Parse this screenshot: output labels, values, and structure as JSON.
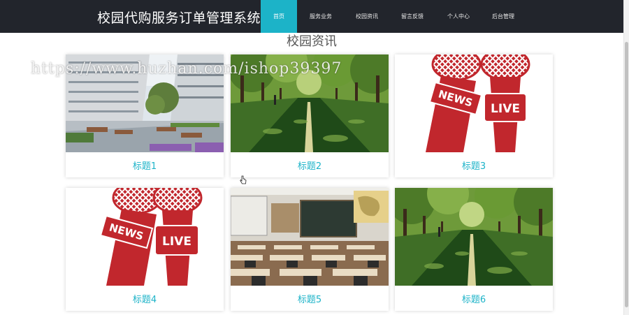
{
  "header": {
    "title": "校园代购服务订单管理系统",
    "nav": [
      {
        "label": "首页",
        "active": true
      },
      {
        "label": "服务业务",
        "active": false
      },
      {
        "label": "校园资讯",
        "active": false
      },
      {
        "label": "留言反馈",
        "active": false
      },
      {
        "label": "个人中心",
        "active": false
      },
      {
        "label": "后台管理",
        "active": false
      }
    ]
  },
  "section": {
    "title": "校园资讯"
  },
  "cards": [
    {
      "title": "标题1",
      "image": "campus-building"
    },
    {
      "title": "标题2",
      "image": "tree-road"
    },
    {
      "title": "标题3",
      "image": "news-live-microphones"
    },
    {
      "title": "标题4",
      "image": "news-live-microphones"
    },
    {
      "title": "标题5",
      "image": "classroom"
    },
    {
      "title": "标题6",
      "image": "tree-road"
    }
  ],
  "watermark": "https://www.huzhan.com/ishop39397",
  "colors": {
    "header_bg": "#22252c",
    "accent": "#1cb3c8",
    "mic_red": "#c1272d"
  }
}
